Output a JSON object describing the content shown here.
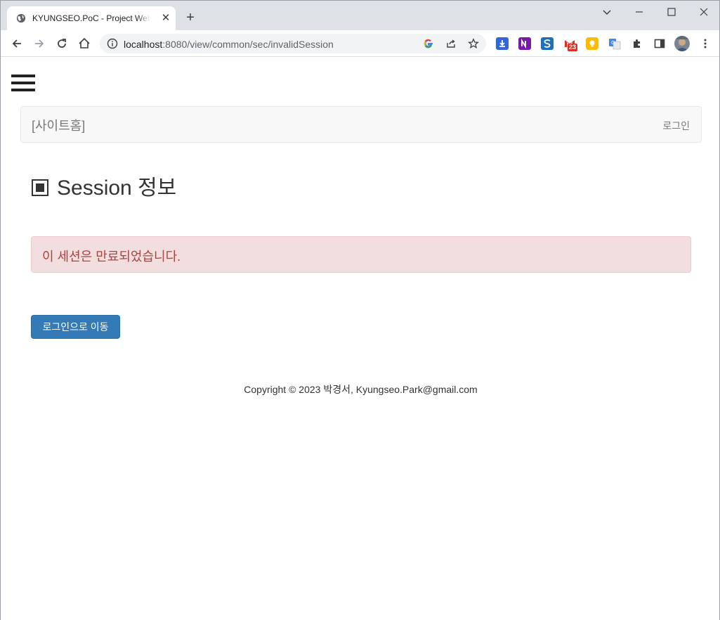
{
  "browser": {
    "tab_title": "KYUNGSEO.PoC - Project Web Site",
    "tab_close": "✕",
    "new_tab": "+",
    "url_host": "localhost",
    "url_path": ":8080/view/common/sec/invalidSession",
    "gmail_badge": "23"
  },
  "page": {
    "site_home": "[사이트홈]",
    "login_link": "로그인",
    "title": "Session 정보",
    "alert_message": "이 세션은 만료되었습니다.",
    "goto_login_button": "로그인으로 이동",
    "copyright": "Copyright © 2023 박경서, Kyungseo.Park@gmail.com"
  },
  "colors": {
    "alert_bg": "#f2dede",
    "alert_text": "#a94442",
    "primary": "#337ab7"
  }
}
